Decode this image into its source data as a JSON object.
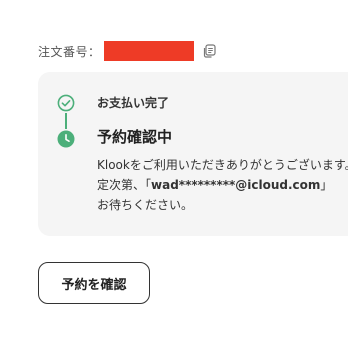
{
  "order": {
    "label": "注文番号："
  },
  "status": {
    "step_done_label": "お支払い完了",
    "step_current_title": "予約確認中",
    "desc_line1": "Klookをご利用いただきありがとうございます。",
    "desc_line2_prefix": "定次第、「",
    "desc_email": "wad*********@icloud.com",
    "desc_line2_suffix": "」",
    "desc_line3": "お待ちください。"
  },
  "actions": {
    "confirm_button_label": "予約を確認"
  },
  "colors": {
    "redaction": "#ee3b26",
    "success_green": "#4caf7a",
    "card_background": "#f5f5f5"
  },
  "icons": {
    "copy": "copy-icon",
    "step_done": "check-circle-icon",
    "step_current": "clock-icon"
  }
}
